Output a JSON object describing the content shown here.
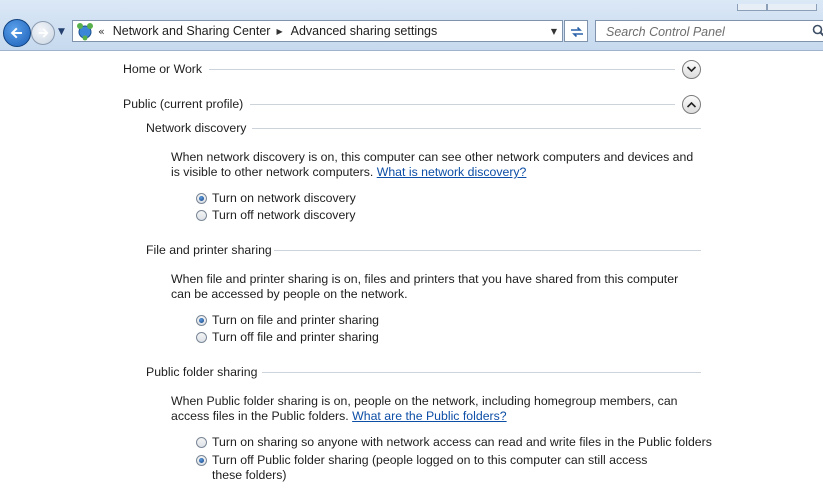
{
  "nav": {
    "back_icon": "back-arrow-icon",
    "forward_icon": "forward-arrow-icon",
    "recent_icon": "chevron-down-icon",
    "breadcrumb_overflow": "«",
    "breadcrumb": [
      "Network and Sharing Center",
      "Advanced sharing settings"
    ],
    "search_placeholder": "Search Control Panel"
  },
  "profiles": [
    {
      "label": "Home or Work",
      "expanded": false
    },
    {
      "label": "Public (current profile)",
      "expanded": true
    }
  ],
  "sections": [
    {
      "title": "Network discovery",
      "description": "When network discovery is on, this computer can see other network computers and devices and is visible to other network computers.",
      "link": "What is network discovery?",
      "options": [
        {
          "label": "Turn on network discovery",
          "selected": true
        },
        {
          "label": "Turn off network discovery",
          "selected": false
        }
      ]
    },
    {
      "title": "File and printer sharing",
      "description": "When file and printer sharing is on, files and printers that you have shared from this computer can be accessed by people on the network.",
      "link": "",
      "options": [
        {
          "label": "Turn on file and printer sharing",
          "selected": true
        },
        {
          "label": "Turn off file and printer sharing",
          "selected": false
        }
      ]
    },
    {
      "title": "Public folder sharing",
      "description": "When Public folder sharing is on, people on the network, including homegroup members, can access files in the Public folders.",
      "link": "What are the Public folders?",
      "options": [
        {
          "label": "Turn on sharing so anyone with network access can read and write files in the Public folders",
          "selected": false
        },
        {
          "label": "Turn off Public folder sharing (people logged on to this computer can still access these folders)",
          "selected": true
        }
      ]
    }
  ]
}
